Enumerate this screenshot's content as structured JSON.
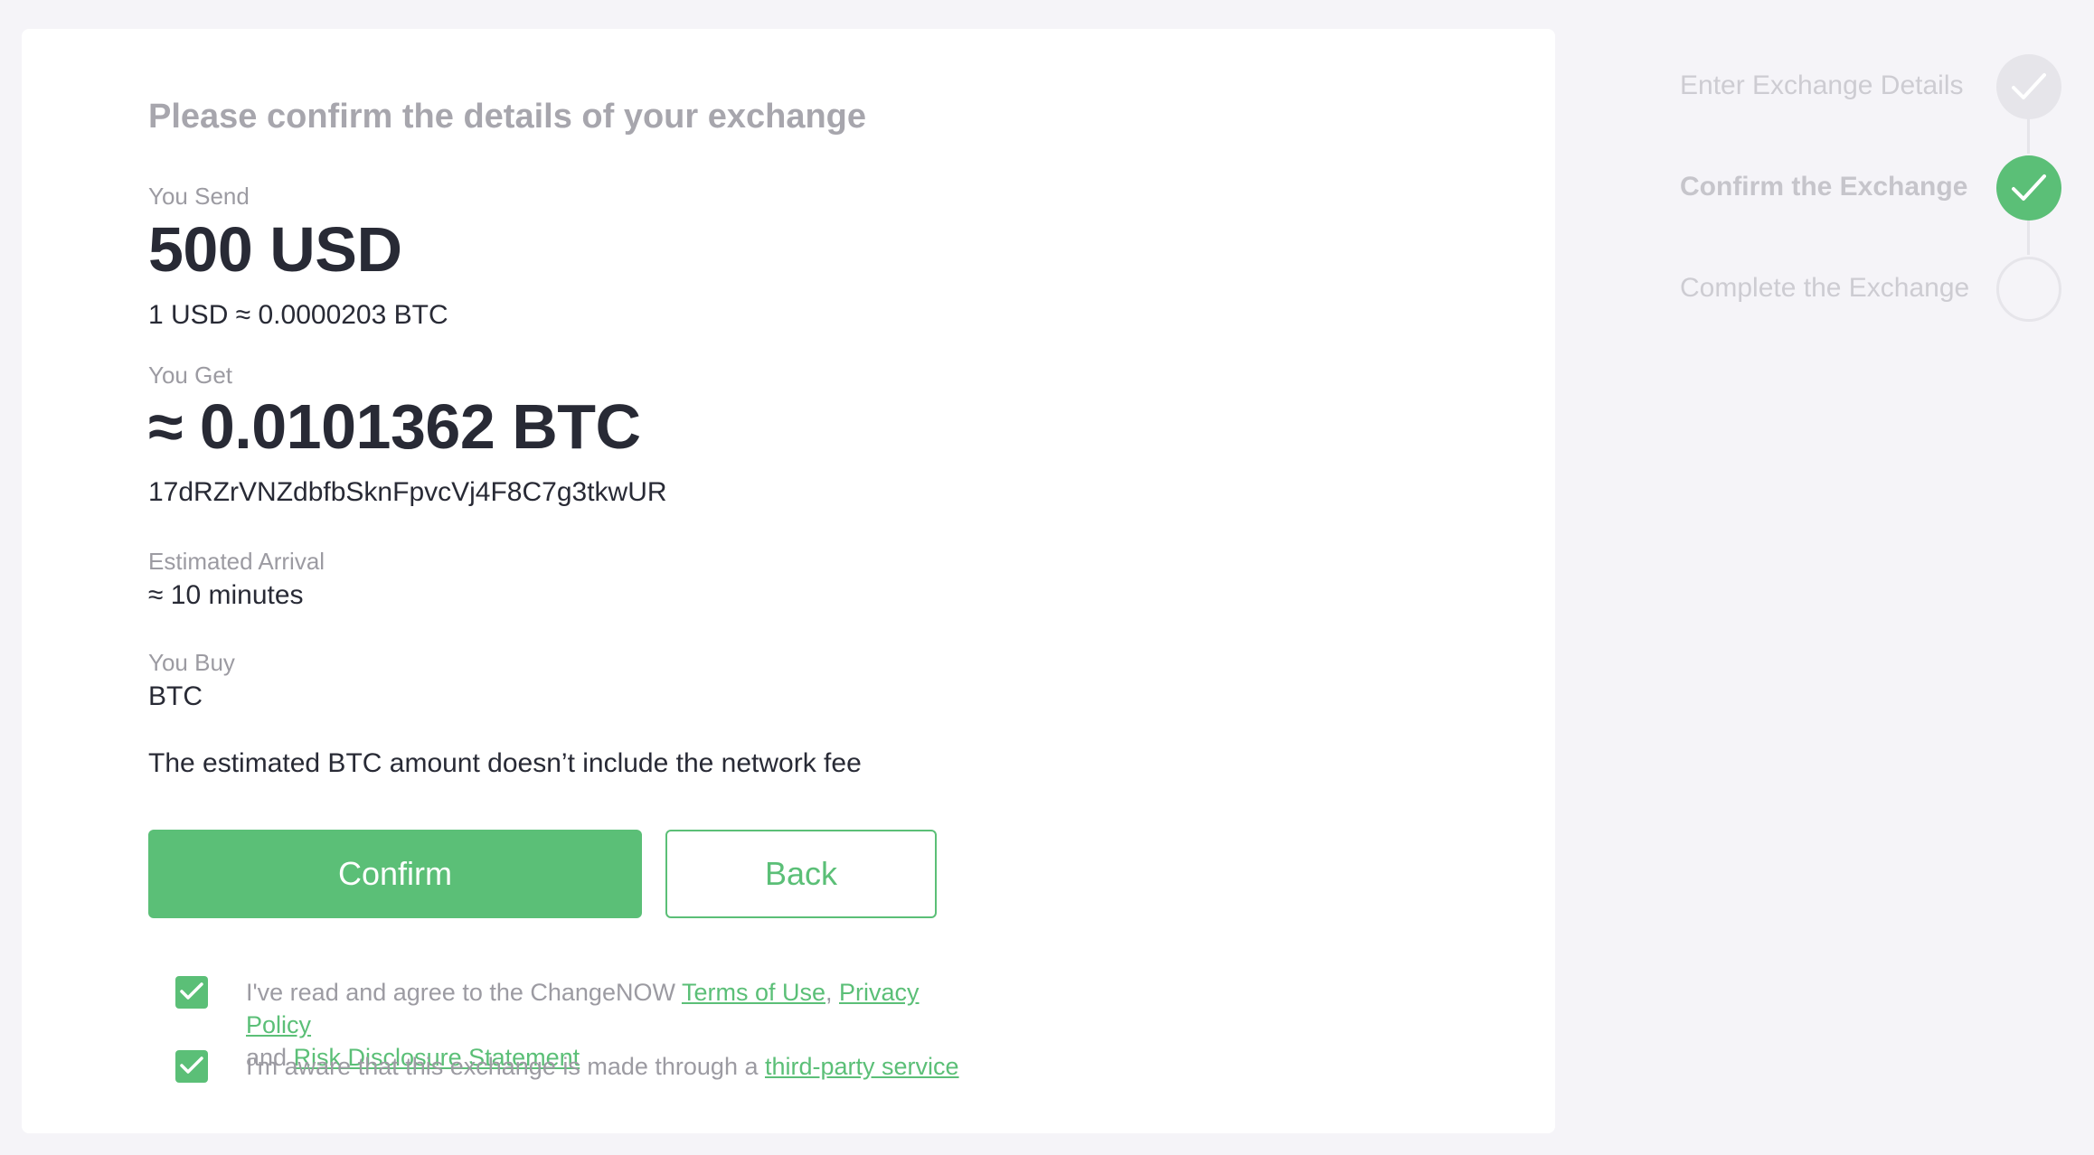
{
  "page": {
    "heading": "Please confirm the details of your exchange"
  },
  "send": {
    "label": "You Send",
    "amount": "500 USD",
    "rate": "1 USD ≈ 0.0000203 BTC"
  },
  "get": {
    "label": "You Get",
    "amount": "≈ 0.0101362 BTC",
    "address": "17dRZrVNZdbfbSknFpvcVj4F8C7g3tkwUR"
  },
  "arrival": {
    "label": "Estimated Arrival",
    "value": "≈ 10 minutes"
  },
  "buy": {
    "label": "You Buy",
    "value": "BTC"
  },
  "note": "The estimated BTC amount doesn’t include the network fee",
  "buttons": {
    "confirm": "Confirm",
    "back": "Back"
  },
  "agreements": {
    "terms": {
      "checked": true,
      "prefix": "I've read and agree to the ChangeNOW ",
      "terms_link": "Terms of Use",
      "comma": ", ",
      "privacy_link": "Privacy Policy",
      "and": " and ",
      "risk_link": "Risk Disclosure Statement"
    },
    "third_party": {
      "checked": true,
      "prefix": "I'm aware that this exchange is made through a ",
      "link": "third-party service"
    }
  },
  "stepper": {
    "steps": [
      {
        "label": "Enter Exchange Details",
        "state": "done"
      },
      {
        "label": "Confirm the Exchange",
        "state": "active"
      },
      {
        "label": "Complete the Exchange",
        "state": "pending"
      }
    ]
  },
  "colors": {
    "accent": "#5bbf77",
    "page_bg": "#f5f4f8",
    "text_dark": "#282a35",
    "text_muted": "#9c9ba2"
  }
}
